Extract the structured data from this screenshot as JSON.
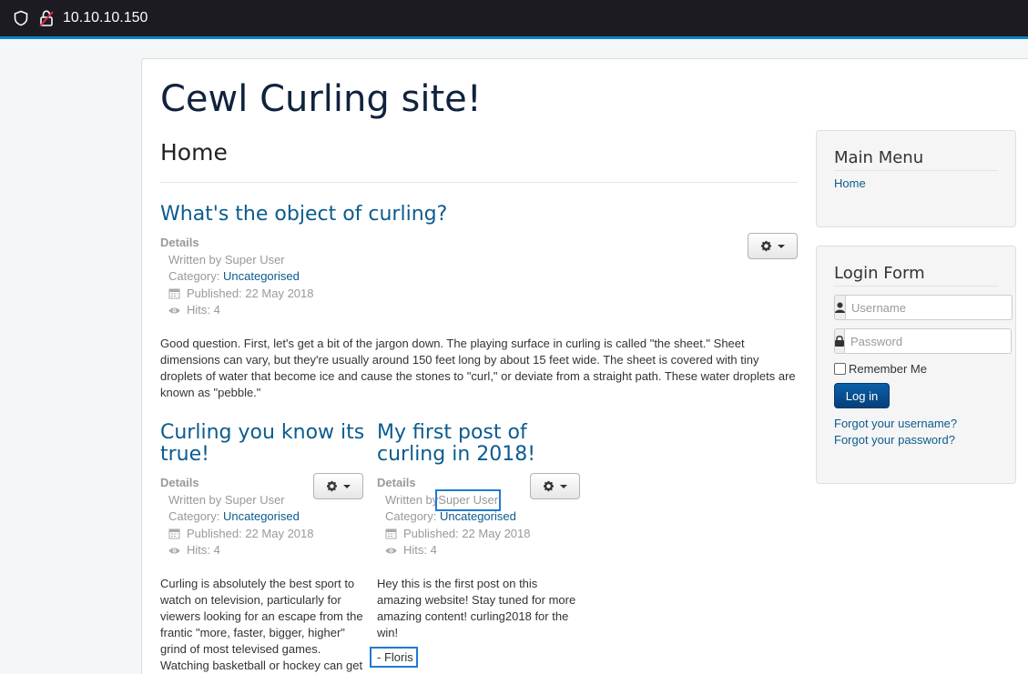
{
  "browser": {
    "url": "10.10.10.150"
  },
  "site": {
    "title": "Cewl Curling site!",
    "page_heading": "Home"
  },
  "articles": [
    {
      "title": "What's the object of curling?",
      "details_label": "Details",
      "written_by": "Written by Super User",
      "category_prefix": "Category: ",
      "category": "Uncategorised",
      "published": "Published: 22 May 2018",
      "hits": "Hits: 4",
      "body": "Good question. First, let's get a bit of the jargon down. The playing surface in curling is called \"the sheet.\" Sheet dimensions can vary, but they're usually around 150 feet long by about 15 feet wide. The sheet is covered with tiny droplets of water that become ice and cause the stones to \"curl,\" or deviate from a straight path. These water droplets are known as \"pebble.\""
    },
    {
      "title": "Curling you know its true!",
      "details_label": "Details",
      "written_by": "Written by Super User",
      "category_prefix": "Category: ",
      "category": "Uncategorised",
      "published": "Published: 22 May 2018",
      "hits": "Hits: 4",
      "body": "Curling is absolutely the best sport to watch on television, particularly for viewers looking for an escape from the frantic \"more, faster, bigger, higher\" grind of most televised games. Watching basketball or hockey can get"
    },
    {
      "title": "My first post of curling in 2018!",
      "details_label": "Details",
      "written_by_prefix": "Written by ",
      "author": "Super User",
      "category_prefix": "Category: ",
      "category": "Uncategorised",
      "published": "Published: 22 May 2018",
      "hits": "Hits: 4",
      "body": "Hey this is the first post on this amazing website! Stay tuned for more amazing content! curling2018 for the win!",
      "signature": "- Floris"
    }
  ],
  "sidebar": {
    "main_menu": {
      "title": "Main Menu",
      "items": [
        "Home"
      ]
    },
    "login": {
      "title": "Login Form",
      "username_placeholder": "Username",
      "password_placeholder": "Password",
      "remember_label": "Remember Me",
      "login_button": "Log in",
      "forgot_username": "Forgot your username?",
      "forgot_password": "Forgot your password?"
    }
  },
  "colors": {
    "link": "#0c5b8e",
    "title": "#10223e",
    "highlight": "#1f7ad6",
    "button": "#0a5fa8"
  }
}
